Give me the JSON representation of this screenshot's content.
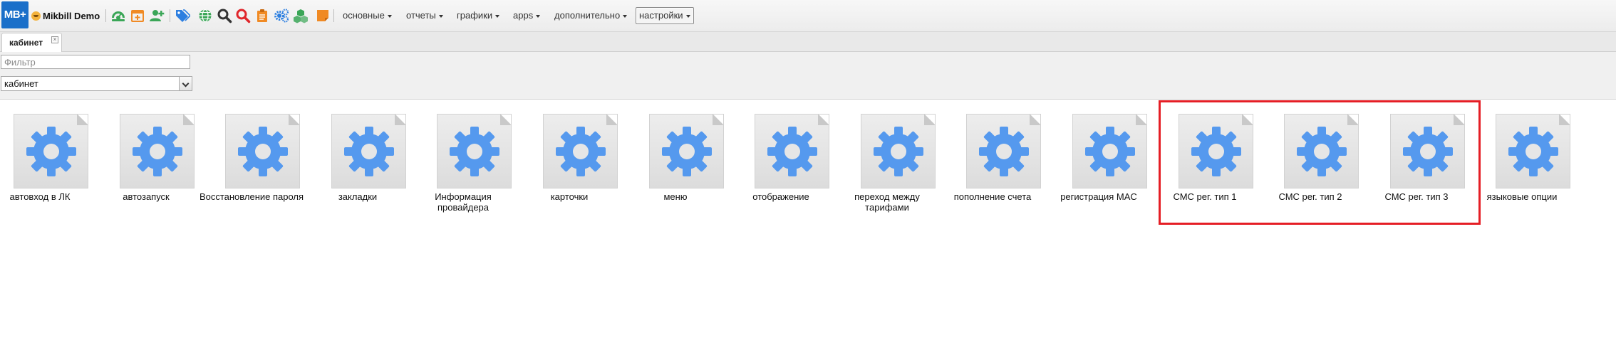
{
  "app": {
    "logo_text": "MB+",
    "brand": "Mikbill Demo"
  },
  "toolbar": {
    "icons": [
      {
        "name": "dashboard-icon",
        "color": "#3aa657"
      },
      {
        "name": "calendar-add-icon",
        "color": "#f08a24"
      },
      {
        "name": "add-user-icon",
        "color": "#3aa657"
      },
      {
        "name": "tags-icon",
        "color": "#2d7fe0"
      },
      {
        "name": "globe-icon",
        "color": "#3aa657"
      },
      {
        "name": "search-icon",
        "color": "#333333"
      },
      {
        "name": "search-red-icon",
        "color": "#e0262b"
      },
      {
        "name": "clipboard-icon",
        "color": "#f08a24"
      },
      {
        "name": "gears-icon",
        "color": "#2d7fe0"
      },
      {
        "name": "cubes-icon",
        "color": "#3aa657"
      },
      {
        "name": "sticky-note-icon",
        "color": "#f08a24"
      }
    ],
    "menus": [
      {
        "label": "основные"
      },
      {
        "label": "отчеты"
      },
      {
        "label": "графики"
      },
      {
        "label": "apps"
      },
      {
        "label": "дополнительно"
      },
      {
        "label": "настройки",
        "active": true
      }
    ]
  },
  "tabs": [
    {
      "label": "кабинет"
    }
  ],
  "filter": {
    "placeholder": "Фильтр",
    "value": ""
  },
  "category_select": {
    "selected": "кабинет"
  },
  "items": [
    {
      "label": "автовход в ЛК"
    },
    {
      "label": "автозапуск"
    },
    {
      "label": "Восстановление пароля"
    },
    {
      "label": "закладки"
    },
    {
      "label": "Информация провайдера"
    },
    {
      "label": "карточки"
    },
    {
      "label": "меню"
    },
    {
      "label": "отображение"
    },
    {
      "label": "переход между тарифами"
    },
    {
      "label": "пополнение счета"
    },
    {
      "label": "регистрация MAC"
    },
    {
      "label": "СМС рег. тип 1"
    },
    {
      "label": "СМС рег. тип 2"
    },
    {
      "label": "СМС рег. тип 3"
    },
    {
      "label": "языковые опции"
    }
  ],
  "item_icon": {
    "name": "gear-icon",
    "color": "#5599ee"
  },
  "highlight_color": "#e51e25"
}
